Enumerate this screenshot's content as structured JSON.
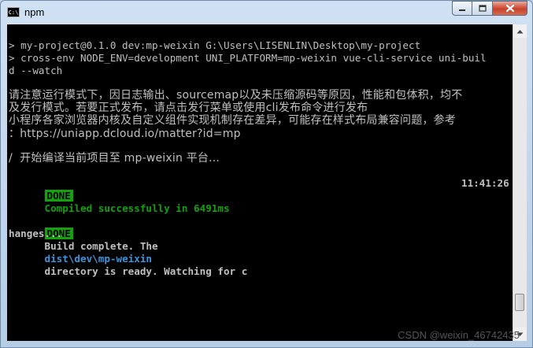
{
  "window": {
    "title": "npm",
    "icon_text": "C:\\"
  },
  "console": {
    "line1": "> my-project@0.1.0 dev:mp-weixin G:\\Users\\LISENLIN\\Desktop\\my-project",
    "line2": "> cross-env NODE_ENV=development UNI_PLATFORM=mp-weixin vue-cli-service uni-buil",
    "line3": "d --watch",
    "notice1": "请注意运行模式下，因日志输出、sourcemap以及未压缩源码等原因，性能和包体积，均不",
    "notice2": "及发行模式。若要正式发布，请点击发行菜单或使用cli发布命令进行发布",
    "notice3": "小程序各家浏览器内核及自定义组件实现机制存在差异，可能存在样式布局兼容问题，参考",
    "notice4": "：https://uniapp.dcloud.io/matter?id=mp",
    "compiling": "/  开始编译当前项目至 mp-weixin 平台...",
    "done1": {
      "badge": "DONE",
      "message": "Compiled successfully in 6491ms",
      "time": "11:41:26"
    },
    "done2": {
      "badge": "DONE",
      "text_a": "Build complete. The",
      "path": "dist\\dev\\mp-weixin",
      "text_b": "directory is ready. Watching for c",
      "text_c": "hanges..."
    }
  },
  "watermark": "CSDN @weixin_46742435"
}
